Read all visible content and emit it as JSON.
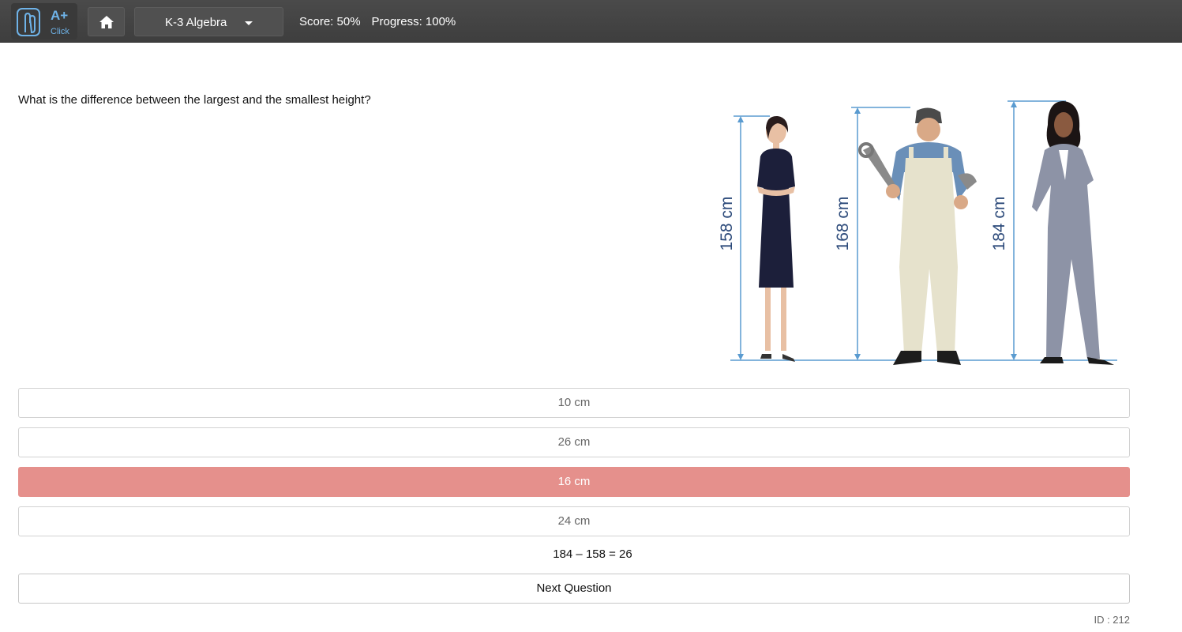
{
  "header": {
    "logo_text": "A+",
    "logo_subtext": "Click",
    "course_title": "K-3 Algebra",
    "score": "Score: 50%",
    "progress": "Progress: 100%"
  },
  "question": {
    "text": "What is the difference between the largest and the smallest height?",
    "figure": {
      "people": [
        {
          "height_label": "158 cm"
        },
        {
          "height_label": "168 cm"
        },
        {
          "height_label": "184 cm"
        }
      ]
    }
  },
  "choices": [
    {
      "label": "10 cm",
      "state": "normal"
    },
    {
      "label": "26 cm",
      "state": "normal"
    },
    {
      "label": "16 cm",
      "state": "wrong"
    },
    {
      "label": "24 cm",
      "state": "normal"
    }
  ],
  "explanation": "184 – 158 = 26",
  "next_button": "Next Question",
  "question_id": "ID : 212",
  "colors": {
    "topbar": "#444444",
    "wrong_choice": "#e5908c",
    "measure_line": "#5a9bd0",
    "label_text": "#2c4a7a"
  }
}
